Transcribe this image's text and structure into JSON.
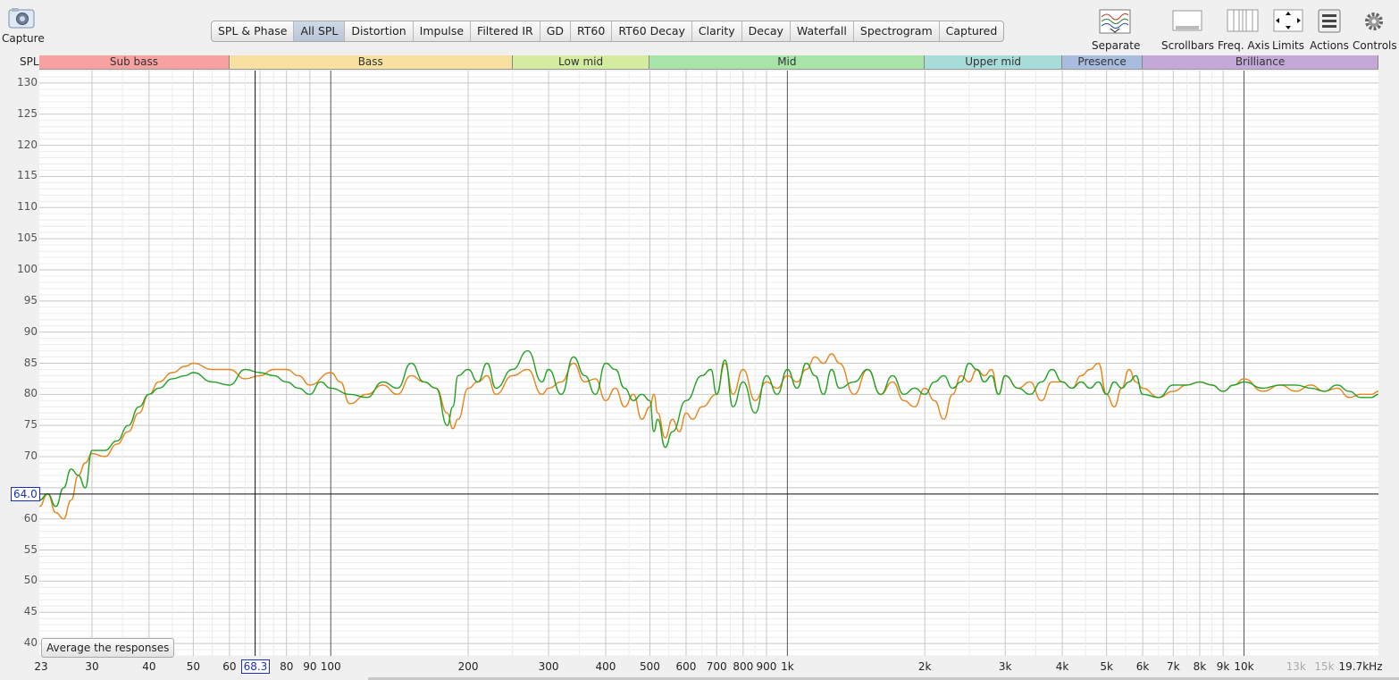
{
  "capture": {
    "label": "Capture",
    "icon": "camera-icon"
  },
  "tabs": [
    {
      "label": "SPL & Phase",
      "active": false
    },
    {
      "label": "All SPL",
      "active": true
    },
    {
      "label": "Distortion",
      "active": false
    },
    {
      "label": "Impulse",
      "active": false
    },
    {
      "label": "Filtered IR",
      "active": false
    },
    {
      "label": "GD",
      "active": false
    },
    {
      "label": "RT60",
      "active": false
    },
    {
      "label": "RT60 Decay",
      "active": false
    },
    {
      "label": "Clarity",
      "active": false
    },
    {
      "label": "Decay",
      "active": false
    },
    {
      "label": "Waterfall",
      "active": false
    },
    {
      "label": "Spectrogram",
      "active": false
    },
    {
      "label": "Captured",
      "active": false
    }
  ],
  "toolbar": [
    {
      "label": "Separate",
      "icon": "separate-traces-icon"
    },
    {
      "label": "Scrollbars",
      "icon": "scrollbars-icon"
    },
    {
      "label": "Freq. Axis",
      "icon": "frequency-axis-icon"
    },
    {
      "label": "Limits",
      "icon": "limits-arrows-icon"
    },
    {
      "label": "Actions",
      "icon": "actions-list-icon"
    },
    {
      "label": "Controls",
      "icon": "gear-icon"
    }
  ],
  "y_unit": "SPL",
  "x_unit_suffix": "kHz",
  "bands": [
    {
      "label": "Sub bass",
      "from": 23,
      "to": 60,
      "color": "#f7a1a1"
    },
    {
      "label": "Bass",
      "from": 60,
      "to": 250,
      "color": "#f8e0a0"
    },
    {
      "label": "Low mid",
      "from": 250,
      "to": 500,
      "color": "#d3eca0"
    },
    {
      "label": "Mid",
      "from": 500,
      "to": 2000,
      "color": "#a8e4a8"
    },
    {
      "label": "Upper mid",
      "from": 2000,
      "to": 4000,
      "color": "#a8dcd8"
    },
    {
      "label": "Presence",
      "from": 4000,
      "to": 6000,
      "color": "#a8bce0"
    },
    {
      "label": "Brilliance",
      "from": 6000,
      "to": 19700,
      "color": "#c4a8d8"
    }
  ],
  "cursor": {
    "frequency_label": "68.3",
    "frequency": 68.3,
    "spl_label": "64.0",
    "spl": 64.0
  },
  "average_button": "Average the responses",
  "chart_data": {
    "type": "line",
    "x_scale": "log",
    "xlim": [
      23,
      19700
    ],
    "ylim": [
      38,
      132
    ],
    "grid": true,
    "ylabel": "SPL",
    "y_ticks": [
      40,
      45,
      50,
      55,
      60,
      65,
      70,
      75,
      80,
      85,
      90,
      95,
      100,
      105,
      110,
      115,
      120,
      125,
      130
    ],
    "y_tick_labels": [
      "40",
      "45",
      "50",
      "55",
      "60",
      "",
      "70",
      "75",
      "80",
      "85",
      "90",
      "95",
      "100",
      "105",
      "110",
      "115",
      "120",
      "125",
      "130"
    ],
    "x_ticks": [
      {
        "f": 23,
        "label": "23"
      },
      {
        "f": 30,
        "label": "30"
      },
      {
        "f": 40,
        "label": "40"
      },
      {
        "f": 50,
        "label": "50"
      },
      {
        "f": 60,
        "label": "60"
      },
      {
        "f": 80,
        "label": "80"
      },
      {
        "f": 90,
        "label": "90"
      },
      {
        "f": 100,
        "label": "100"
      },
      {
        "f": 200,
        "label": "200"
      },
      {
        "f": 300,
        "label": "300"
      },
      {
        "f": 400,
        "label": "400"
      },
      {
        "f": 500,
        "label": "500"
      },
      {
        "f": 600,
        "label": "600"
      },
      {
        "f": 700,
        "label": "700"
      },
      {
        "f": 800,
        "label": "800"
      },
      {
        "f": 900,
        "label": "900"
      },
      {
        "f": 1000,
        "label": "1k"
      },
      {
        "f": 2000,
        "label": "2k"
      },
      {
        "f": 3000,
        "label": "3k"
      },
      {
        "f": 4000,
        "label": "4k"
      },
      {
        "f": 5000,
        "label": "5k"
      },
      {
        "f": 6000,
        "label": "6k"
      },
      {
        "f": 7000,
        "label": "7k"
      },
      {
        "f": 8000,
        "label": "8k"
      },
      {
        "f": 9000,
        "label": "9k"
      },
      {
        "f": 10000,
        "label": "10k"
      },
      {
        "f": 13000,
        "label": "13k",
        "faint": true
      },
      {
        "f": 15000,
        "label": "15k",
        "faint": true
      },
      {
        "f": 19700,
        "label": "19.7kHz"
      }
    ],
    "series": [
      {
        "color": "#e8831a",
        "points": [
          [
            23,
            62
          ],
          [
            24,
            64
          ],
          [
            25,
            61
          ],
          [
            26,
            60
          ],
          [
            27,
            63
          ],
          [
            28,
            67
          ],
          [
            29,
            69
          ],
          [
            30,
            70.5
          ],
          [
            32,
            70
          ],
          [
            34,
            72
          ],
          [
            36,
            74
          ],
          [
            38,
            77
          ],
          [
            40,
            80
          ],
          [
            42,
            82
          ],
          [
            45,
            83.5
          ],
          [
            48,
            84.5
          ],
          [
            50,
            85
          ],
          [
            55,
            84
          ],
          [
            60,
            84
          ],
          [
            65,
            82.5
          ],
          [
            70,
            83
          ],
          [
            75,
            84
          ],
          [
            80,
            84
          ],
          [
            85,
            83
          ],
          [
            90,
            81.5
          ],
          [
            100,
            83.5
          ],
          [
            105,
            82
          ],
          [
            110,
            78.5
          ],
          [
            120,
            80
          ],
          [
            130,
            81.5
          ],
          [
            140,
            80
          ],
          [
            150,
            83
          ],
          [
            160,
            82
          ],
          [
            170,
            81
          ],
          [
            180,
            77
          ],
          [
            185,
            74.5
          ],
          [
            190,
            76
          ],
          [
            200,
            81
          ],
          [
            210,
            82
          ],
          [
            220,
            83
          ],
          [
            230,
            80
          ],
          [
            250,
            83
          ],
          [
            270,
            84
          ],
          [
            290,
            80
          ],
          [
            300,
            81
          ],
          [
            320,
            82
          ],
          [
            340,
            85
          ],
          [
            360,
            82
          ],
          [
            380,
            82.5
          ],
          [
            400,
            79
          ],
          [
            420,
            81
          ],
          [
            440,
            78
          ],
          [
            460,
            80
          ],
          [
            480,
            76
          ],
          [
            500,
            78
          ],
          [
            510,
            80
          ],
          [
            520,
            77
          ],
          [
            540,
            73
          ],
          [
            560,
            76
          ],
          [
            580,
            74
          ],
          [
            600,
            77
          ],
          [
            620,
            76
          ],
          [
            650,
            78
          ],
          [
            700,
            80
          ],
          [
            730,
            85
          ],
          [
            760,
            80
          ],
          [
            800,
            84
          ],
          [
            850,
            79
          ],
          [
            900,
            82
          ],
          [
            950,
            81
          ],
          [
            1000,
            83
          ],
          [
            1050,
            82
          ],
          [
            1100,
            84
          ],
          [
            1150,
            86
          ],
          [
            1200,
            85
          ],
          [
            1250,
            86.5
          ],
          [
            1300,
            85
          ],
          [
            1400,
            80
          ],
          [
            1500,
            84
          ],
          [
            1600,
            80
          ],
          [
            1700,
            82
          ],
          [
            1800,
            79
          ],
          [
            1900,
            78
          ],
          [
            2000,
            81
          ],
          [
            2100,
            79
          ],
          [
            2200,
            76
          ],
          [
            2300,
            80
          ],
          [
            2400,
            83
          ],
          [
            2500,
            82
          ],
          [
            2600,
            84
          ],
          [
            2700,
            83
          ],
          [
            2800,
            84
          ],
          [
            2900,
            80
          ],
          [
            3000,
            83
          ],
          [
            3200,
            81
          ],
          [
            3400,
            82
          ],
          [
            3600,
            79
          ],
          [
            3800,
            82
          ],
          [
            4000,
            82
          ],
          [
            4200,
            81
          ],
          [
            4400,
            83
          ],
          [
            4600,
            84
          ],
          [
            4800,
            85
          ],
          [
            5000,
            80
          ],
          [
            5200,
            78
          ],
          [
            5400,
            81
          ],
          [
            5600,
            84
          ],
          [
            5800,
            82
          ],
          [
            6000,
            81
          ],
          [
            6500,
            79.5
          ],
          [
            7000,
            80.5
          ],
          [
            7500,
            81.5
          ],
          [
            8000,
            82
          ],
          [
            8500,
            81.5
          ],
          [
            9000,
            80.5
          ],
          [
            9500,
            81.5
          ],
          [
            10000,
            82.5
          ],
          [
            11000,
            80.5
          ],
          [
            12000,
            81.5
          ],
          [
            13000,
            80.5
          ],
          [
            14000,
            81.5
          ],
          [
            15000,
            80.5
          ],
          [
            16000,
            81
          ],
          [
            17000,
            79.5
          ],
          [
            18000,
            80
          ],
          [
            19000,
            80
          ],
          [
            19700,
            80.5
          ]
        ]
      },
      {
        "color": "#22a022",
        "points": [
          [
            23,
            63
          ],
          [
            24,
            64
          ],
          [
            25,
            62
          ],
          [
            26,
            65
          ],
          [
            27,
            68
          ],
          [
            28,
            67
          ],
          [
            29,
            65
          ],
          [
            30,
            71
          ],
          [
            32,
            71
          ],
          [
            34,
            72.5
          ],
          [
            36,
            75
          ],
          [
            38,
            78
          ],
          [
            40,
            80
          ],
          [
            42,
            81
          ],
          [
            45,
            82.5
          ],
          [
            48,
            83
          ],
          [
            50,
            83.5
          ],
          [
            55,
            82
          ],
          [
            60,
            81.5
          ],
          [
            65,
            84
          ],
          [
            70,
            83.5
          ],
          [
            75,
            83
          ],
          [
            80,
            82
          ],
          [
            85,
            81
          ],
          [
            90,
            80
          ],
          [
            95,
            82
          ],
          [
            100,
            81
          ],
          [
            110,
            80
          ],
          [
            120,
            79.5
          ],
          [
            130,
            82
          ],
          [
            140,
            81
          ],
          [
            150,
            85
          ],
          [
            160,
            82
          ],
          [
            170,
            81
          ],
          [
            180,
            75
          ],
          [
            185,
            78
          ],
          [
            190,
            83
          ],
          [
            200,
            84
          ],
          [
            210,
            82
          ],
          [
            220,
            85
          ],
          [
            230,
            81
          ],
          [
            250,
            84
          ],
          [
            270,
            87
          ],
          [
            290,
            82
          ],
          [
            300,
            84
          ],
          [
            320,
            80
          ],
          [
            340,
            86
          ],
          [
            360,
            83
          ],
          [
            380,
            80
          ],
          [
            400,
            85
          ],
          [
            420,
            84
          ],
          [
            440,
            81
          ],
          [
            460,
            79
          ],
          [
            480,
            80
          ],
          [
            500,
            79
          ],
          [
            510,
            74
          ],
          [
            520,
            76
          ],
          [
            540,
            71.5
          ],
          [
            560,
            74
          ],
          [
            600,
            79
          ],
          [
            650,
            83
          ],
          [
            680,
            84
          ],
          [
            700,
            80
          ],
          [
            730,
            85.5
          ],
          [
            760,
            78
          ],
          [
            800,
            82
          ],
          [
            850,
            77
          ],
          [
            900,
            83
          ],
          [
            950,
            80
          ],
          [
            1000,
            84
          ],
          [
            1050,
            81
          ],
          [
            1100,
            85
          ],
          [
            1150,
            83
          ],
          [
            1200,
            80
          ],
          [
            1250,
            84
          ],
          [
            1300,
            81
          ],
          [
            1400,
            82
          ],
          [
            1500,
            84
          ],
          [
            1600,
            80
          ],
          [
            1700,
            83
          ],
          [
            1800,
            80
          ],
          [
            1900,
            81
          ],
          [
            2000,
            80
          ],
          [
            2100,
            82
          ],
          [
            2200,
            83
          ],
          [
            2300,
            81
          ],
          [
            2400,
            82
          ],
          [
            2500,
            85
          ],
          [
            2600,
            84
          ],
          [
            2700,
            82
          ],
          [
            2800,
            83
          ],
          [
            2900,
            80
          ],
          [
            3000,
            83
          ],
          [
            3200,
            81
          ],
          [
            3400,
            80
          ],
          [
            3600,
            82
          ],
          [
            3800,
            84
          ],
          [
            4000,
            82
          ],
          [
            4200,
            81
          ],
          [
            4400,
            82
          ],
          [
            4600,
            81
          ],
          [
            4800,
            82
          ],
          [
            5000,
            80
          ],
          [
            5200,
            82
          ],
          [
            5400,
            81
          ],
          [
            5600,
            82
          ],
          [
            5800,
            83
          ],
          [
            6000,
            80
          ],
          [
            6500,
            79.5
          ],
          [
            7000,
            81.5
          ],
          [
            7500,
            81.5
          ],
          [
            8000,
            82
          ],
          [
            8500,
            81.5
          ],
          [
            9000,
            80.5
          ],
          [
            9500,
            81.5
          ],
          [
            10000,
            82
          ],
          [
            11000,
            81
          ],
          [
            12000,
            81.5
          ],
          [
            13000,
            81.5
          ],
          [
            14000,
            81
          ],
          [
            15000,
            80.5
          ],
          [
            16000,
            81.5
          ],
          [
            17000,
            80.5
          ],
          [
            18000,
            79.5
          ],
          [
            19000,
            79.5
          ],
          [
            19700,
            80
          ]
        ]
      }
    ]
  }
}
